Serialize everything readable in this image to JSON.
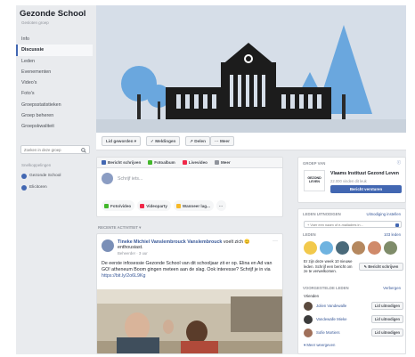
{
  "group": {
    "name": "Gezonde School",
    "type": "Gesloten groep"
  },
  "nav": [
    "Info",
    "Discussie",
    "Leden",
    "Evenementen",
    "Video's",
    "Foto's",
    "Groepsstatistieken",
    "Groep beheren",
    "Groepskwaliteit"
  ],
  "sidebar": {
    "search_placeholder": "Zoeken in deze groep",
    "shortcuts_heading": "Snelkoppelingen",
    "shortcuts": [
      "Gezonde School",
      "Elicitoren"
    ]
  },
  "actions": {
    "member": "Lid geworden ▾",
    "notifications": "✓ Meldingen",
    "share": "↗ Delen",
    "more": "··· Meer"
  },
  "composer": {
    "tabs": [
      "Bericht schrijven",
      "Fotoalbum",
      "Livevideo",
      "Meer"
    ],
    "placeholder": "Schrijf iets...",
    "buttons": [
      "Foto/video",
      "Videoparty",
      "Wanneer lag...",
      "···"
    ]
  },
  "recent_activity": "RECENTE ACTIVITEIT ▾",
  "post": {
    "author": "Tineke Michiel Vanslembrouck Vanslembrouck",
    "mood": " voelt zich 😊",
    "mood2": "enthousiast.",
    "role": "Beheerder",
    "time": "3 uur",
    "text": "De eerste infosessie Gezonde School van dit schooljaar zit er op. Elina en Ad van GO! atheneum Boom gingen meteen aan de slag. Ook interesse? Schrijf je in via ",
    "link": "https://bit.ly/2o6L9Kg"
  },
  "right": {
    "admin_heading": "GROEP VAN",
    "org_logo": "GEZOND LEVEN",
    "org_name": "Vlaams Instituut Gezond Leven",
    "org_sub": "22.000 vinden dit leuk",
    "message_btn": "Bericht versturen",
    "invite_heading": "LEDEN UITNODIGEN",
    "invite_link": "Uitnodiging instellen",
    "invite_placeholder": "+ Voer een naam of e-mailadres in...",
    "members_heading": "LEDEN",
    "members_link": "103 leden",
    "new_members_text": "Er zijn deze week 10 nieuwe leden. Schrijf een bericht om ze te verwelkomen.",
    "write_btn": "✎ Bericht schrijven",
    "suggested_heading": "VOORGESTELDE LEDEN",
    "suggested_link": "Verbergen",
    "friends_label": "Vrienden",
    "suggestions": [
      {
        "name": "Jolien Vandewalle",
        "button": "Lid uitnodigen"
      },
      {
        "name": "Vandewalle Mieke",
        "button": "Lid uitnodigen"
      },
      {
        "name": "Sofie Mortiers",
        "button": "Lid uitnodigen"
      }
    ],
    "more_link": "▾ Meer weergeven"
  },
  "colors": {
    "brand": "#4267b2",
    "background": "#e9ebee",
    "cover_sky": "#d6dee8"
  }
}
